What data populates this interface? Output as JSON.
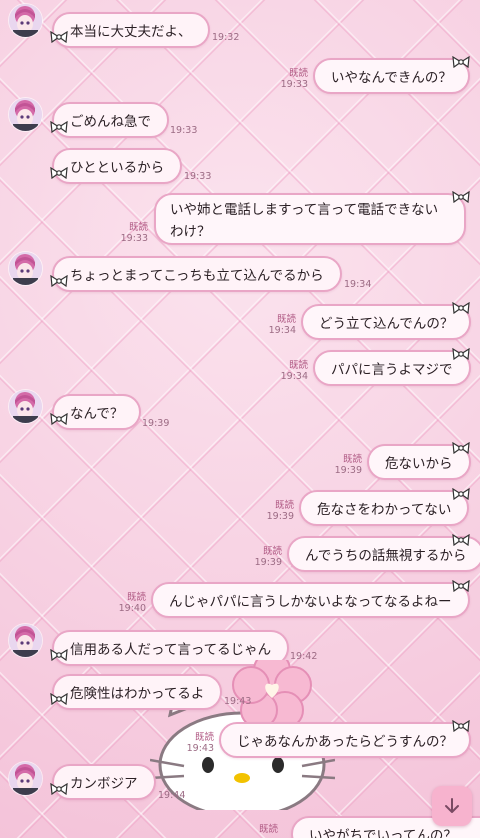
{
  "colors": {
    "bubble_border": "#e9a6c6",
    "bubble_fill": "#fff3f8",
    "wallpaper": "#f6cbe0",
    "read_text": "#b05a84"
  },
  "icons": {
    "avatar": "anime-avatar-icon",
    "bow": "bow-icon",
    "scroll": "arrow-down-icon",
    "decor": "hello-kitty-sticker"
  },
  "messages": [
    {
      "side": "in",
      "text": "本当に大丈夫だよ、",
      "time": "19:32",
      "avatar": true
    },
    {
      "side": "out",
      "text": "いやなんできんの？",
      "time": "19:33",
      "read": "既読"
    },
    {
      "side": "in",
      "text": "ごめんね急で",
      "time": "19:33",
      "avatar": true
    },
    {
      "side": "in",
      "text": "ひとといるから",
      "time": "19:33"
    },
    {
      "side": "out",
      "text": "いや姉と電話しますって言って電話できないわけ？",
      "time": "19:33",
      "read": "既読"
    },
    {
      "side": "in",
      "text": "ちょっとまってこっちも立て込んでるから",
      "time": "19:34",
      "avatar": true
    },
    {
      "side": "out",
      "text": "どう立て込んでんの？",
      "time": "19:34",
      "read": "既読"
    },
    {
      "side": "out",
      "text": "パパに言うよマジで",
      "time": "19:34",
      "read": "既読"
    },
    {
      "side": "in",
      "text": "なんで？",
      "time": "19:39",
      "avatar": true
    },
    {
      "side": "out",
      "text": "危ないから",
      "time": "19:39",
      "read": "既読"
    },
    {
      "side": "out",
      "text": "危なさをわかってない",
      "time": "19:39",
      "read": "既読"
    },
    {
      "side": "out",
      "text": "んでうちの話無視するから",
      "time": "19:39",
      "read": "既読"
    },
    {
      "side": "out",
      "text": "んじゃパパに言うしかないよなってなるよねー",
      "time": "19:40",
      "read": "既読"
    },
    {
      "side": "in",
      "text": "信用ある人だって言ってるじゃん",
      "time": "19:42",
      "avatar": true
    },
    {
      "side": "in",
      "text": "危険性はわかってるよ",
      "time": "19:43"
    },
    {
      "side": "out",
      "text": "じゃあなんかあったらどうすんの？",
      "time": "19:43",
      "read": "既読"
    },
    {
      "side": "in",
      "text": "カンボジア",
      "time": "19:44",
      "avatar": true
    },
    {
      "side": "out",
      "text": "いやがちでいってんの？",
      "time": "",
      "read": "既読"
    }
  ]
}
